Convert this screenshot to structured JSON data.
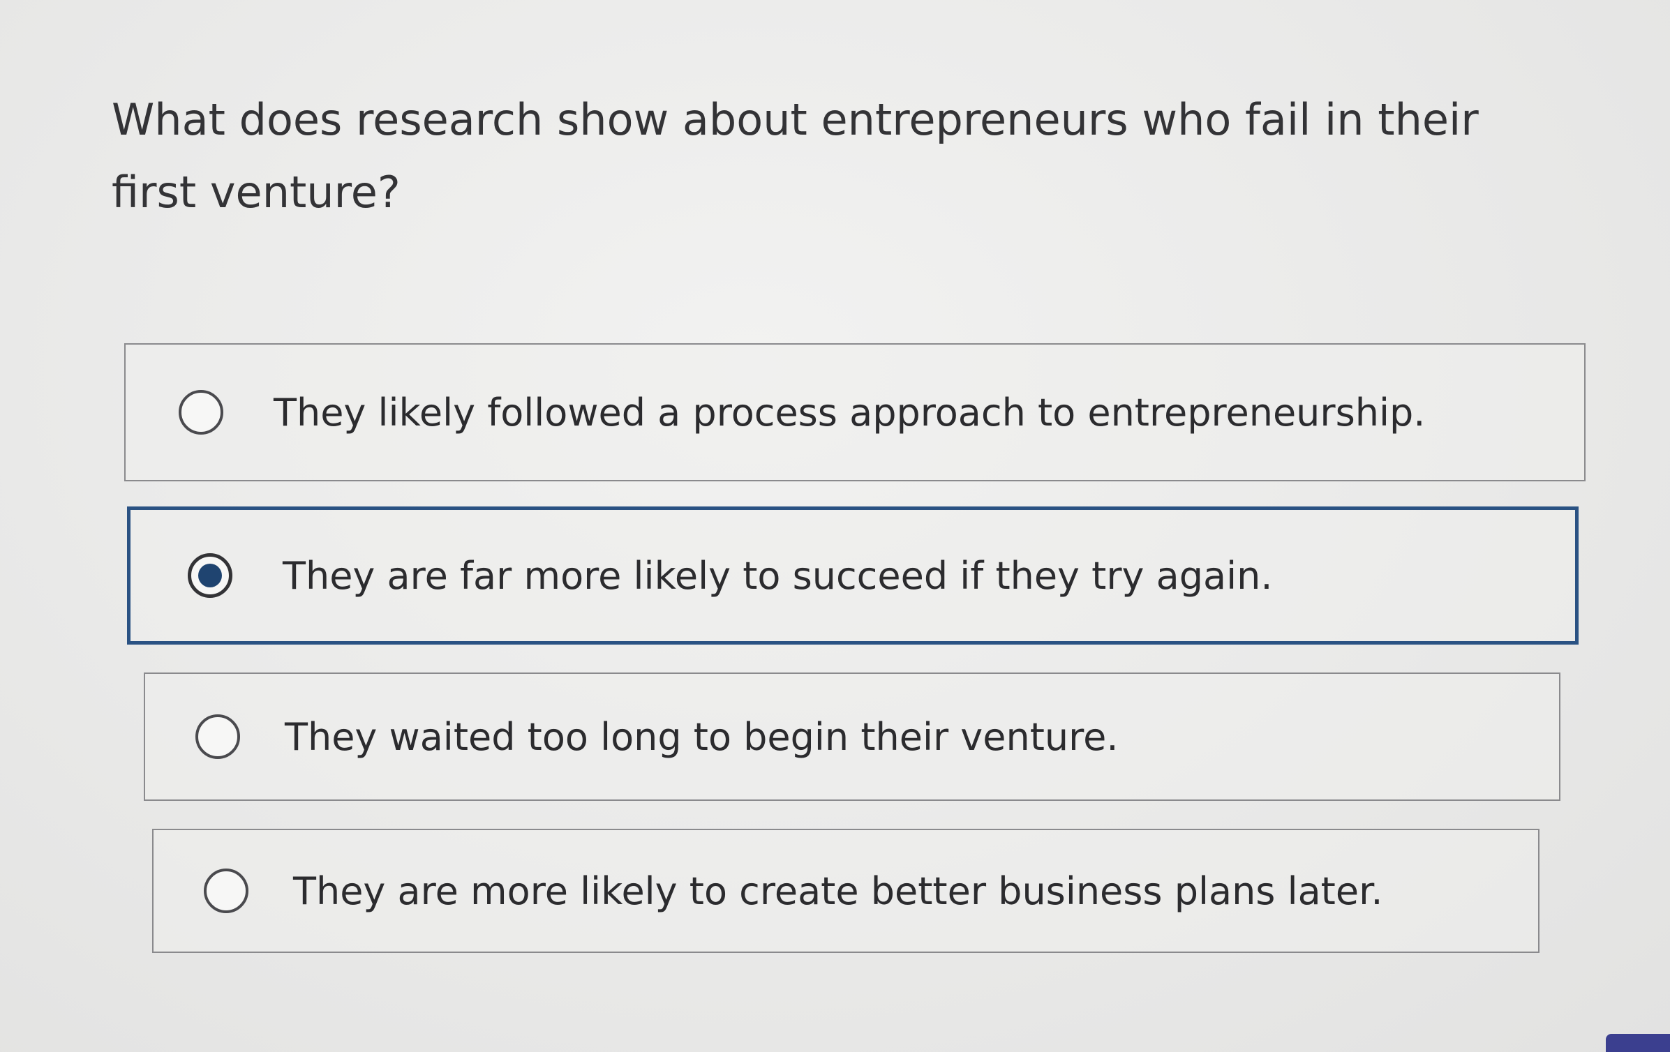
{
  "question": {
    "text": "What does research show about entrepreneurs who fail in their first venture?"
  },
  "options": [
    {
      "label": "They likely followed a process approach to entrepreneurship.",
      "selected": false
    },
    {
      "label": "They are far more likely to succeed if they try again.",
      "selected": true
    },
    {
      "label": "They waited too long to begin their venture.",
      "selected": false
    },
    {
      "label": "They are more likely to create better business plans later.",
      "selected": false
    }
  ],
  "colors": {
    "selected_border": "#2a5283",
    "selected_dot": "#1f4470",
    "corner_tab": "#3b3f8f"
  }
}
